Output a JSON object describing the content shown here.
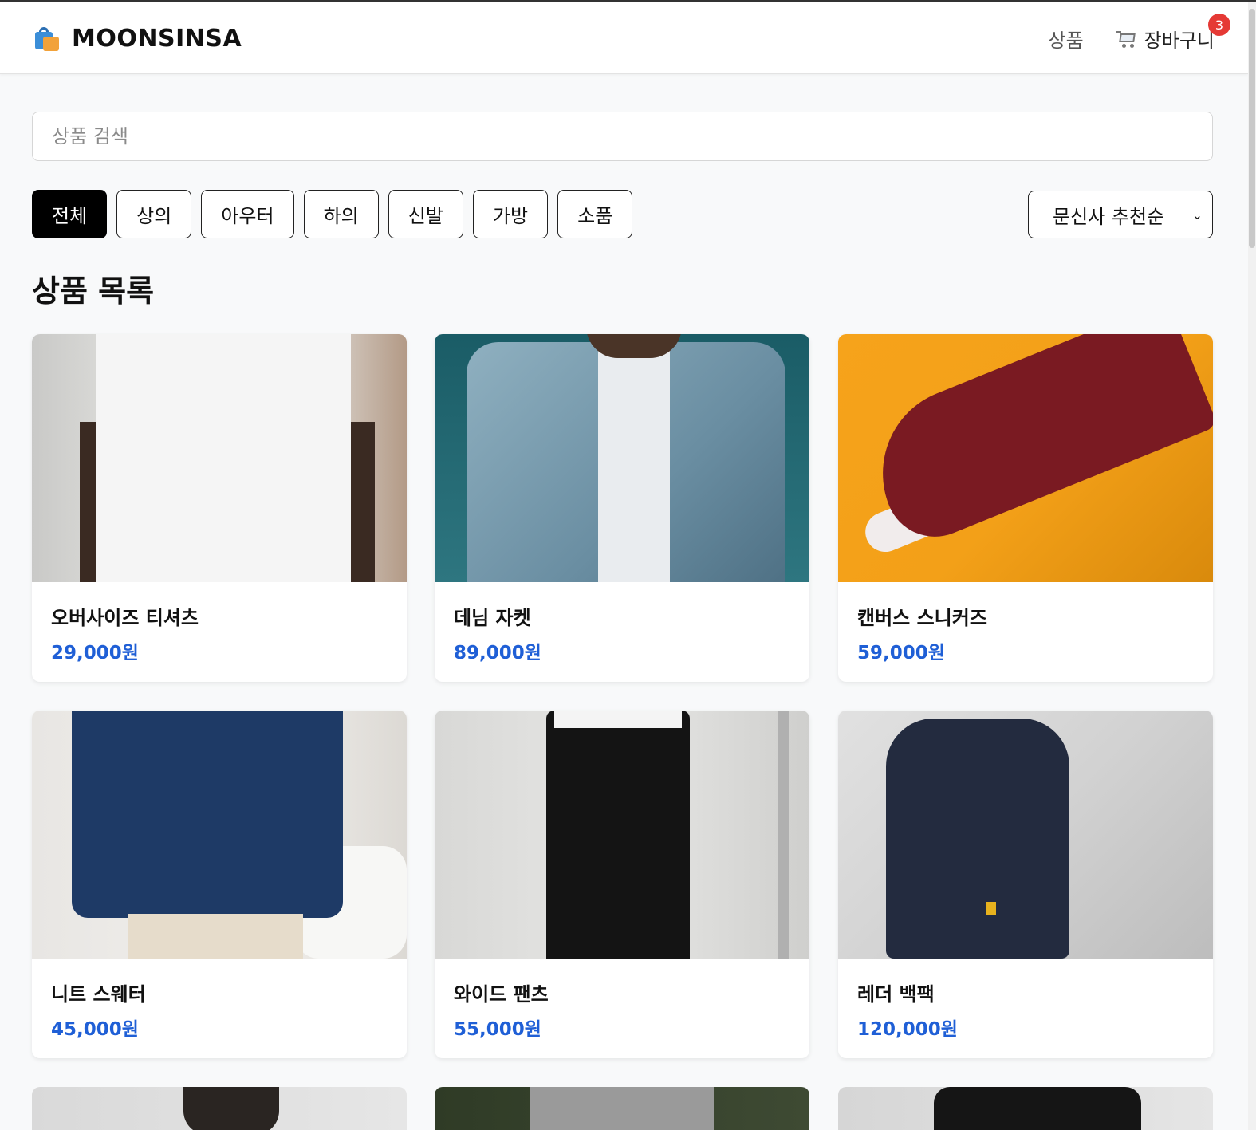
{
  "header": {
    "logo_text": "MOONSINSA",
    "nav_products": "상품",
    "nav_cart": "장바구니",
    "cart_count": "3"
  },
  "search": {
    "placeholder": "상품 검색"
  },
  "filters": {
    "items": [
      "전체",
      "상의",
      "아우터",
      "하의",
      "신발",
      "가방",
      "소품"
    ],
    "active_index": 0
  },
  "sort": {
    "selected": "문신사 추천순"
  },
  "section": {
    "title": "상품 목록"
  },
  "products": [
    {
      "name": "오버사이즈 티셔츠",
      "price": "29,000원",
      "image": "white-tshirt"
    },
    {
      "name": "데님 자켓",
      "price": "89,000원",
      "image": "denim-jacket"
    },
    {
      "name": "캔버스 스니커즈",
      "price": "59,000원",
      "image": "burgundy-sneaker"
    },
    {
      "name": "니트 스웨터",
      "price": "45,000원",
      "image": "navy-knit-sweater"
    },
    {
      "name": "와이드 팬츠",
      "price": "55,000원",
      "image": "black-wide-pants"
    },
    {
      "name": "레더 백팩",
      "price": "120,000원",
      "image": "navy-backpack"
    }
  ],
  "colors": {
    "accent": "#1f5fd6",
    "badge": "#e53935",
    "active_chip": "#000000"
  }
}
